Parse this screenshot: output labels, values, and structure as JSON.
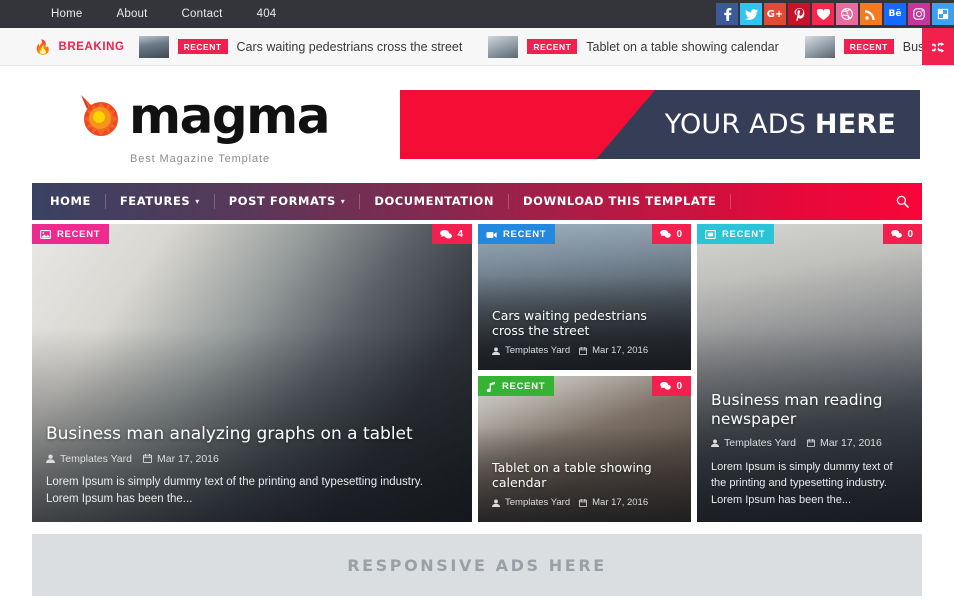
{
  "topbar": {
    "nav": [
      {
        "label": "Home"
      },
      {
        "label": "About"
      },
      {
        "label": "Contact"
      },
      {
        "label": "404"
      }
    ],
    "social": [
      {
        "name": "facebook-icon",
        "glyph": "f",
        "color": "#3b5a9a"
      },
      {
        "name": "twitter-icon",
        "glyph": "t",
        "color": "#31c3f2"
      },
      {
        "name": "googleplus-icon",
        "glyph": "G+",
        "color": "#e04b36"
      },
      {
        "name": "pinterest-icon",
        "glyph": "P",
        "color": "#c8122a"
      },
      {
        "name": "bloglovin-icon",
        "glyph": "♥",
        "color": "#f7274e"
      },
      {
        "name": "dribbble-icon",
        "glyph": "d",
        "color": "#ea6aa0"
      },
      {
        "name": "rss-icon",
        "glyph": "r",
        "color": "#f37a21"
      },
      {
        "name": "behance-icon",
        "glyph": "Bē",
        "color": "#1769ff"
      },
      {
        "name": "instagram-icon",
        "glyph": "o",
        "color": "#c5359a"
      },
      {
        "name": "delicious-icon",
        "glyph": "c",
        "color": "#3ba1f0"
      }
    ]
  },
  "ticker": {
    "label": "BREAKING",
    "badge": "RECENT",
    "items": [
      {
        "title": "Cars waiting pedestrians cross the street"
      },
      {
        "title": "Tablet on a table showing calendar"
      },
      {
        "title": "Business man reading newspaper"
      }
    ],
    "shuffle_icon": "shuffle-icon"
  },
  "header": {
    "brand_name": "magma",
    "tagline": "Best Magazine Template",
    "ad": {
      "text_regular": "YOUR ADS ",
      "text_bold": "HERE"
    }
  },
  "mainnav": {
    "items": [
      {
        "label": "HOME",
        "caret": false
      },
      {
        "label": "FEATURES",
        "caret": true
      },
      {
        "label": "POST FORMATS",
        "caret": true
      },
      {
        "label": "DOCUMENTATION",
        "caret": false
      },
      {
        "label": "DOWNLOAD THIS TEMPLATE",
        "caret": false
      }
    ],
    "search_icon": "search-icon"
  },
  "posts": {
    "featured": {
      "badge": {
        "label": "RECENT",
        "color": "#ef2a8e",
        "icon": "image-icon"
      },
      "comments": "4",
      "title": "Business man analyzing graphs on a tablet",
      "author": "Templates Yard",
      "date": "Mar 17, 2016",
      "excerpt": "Lorem Ipsum is simply dummy text of the printing and typesetting industry. Lorem Ipsum has been the..."
    },
    "mid_top": {
      "badge": {
        "label": "RECENT",
        "color": "#2389e0",
        "icon": "video-icon"
      },
      "comments": "0",
      "title": "Cars waiting pedestrians cross the street",
      "author": "Templates Yard",
      "date": "Mar 17, 2016"
    },
    "mid_bottom": {
      "badge": {
        "label": "RECENT",
        "color": "#35b335",
        "icon": "music-icon"
      },
      "comments": "0",
      "title": "Tablet on a table showing calendar",
      "author": "Templates Yard",
      "date": "Mar 17, 2016"
    },
    "right": {
      "badge": {
        "label": "RECENT",
        "color": "#2bc4d6",
        "icon": "gallery-icon"
      },
      "comments": "0",
      "title": "Business man reading newspaper",
      "author": "Templates Yard",
      "date": "Mar 17, 2016",
      "excerpt": "Lorem Ipsum is simply dummy text of the printing and typesetting industry. Lorem Ipsum has been the..."
    }
  },
  "respads": {
    "text": "RESPONSIVE ADS HERE"
  }
}
